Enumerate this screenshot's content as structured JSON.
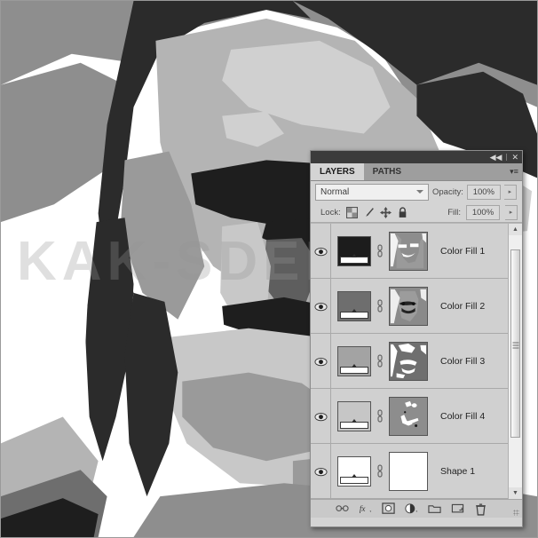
{
  "canvas": {
    "artwork_title": "posterized-grayscale-portrait",
    "watermark_text": "KAK-SDELA"
  },
  "panel": {
    "titlebar": {
      "collapse_icon": "◀◀",
      "close_icon": "✕"
    },
    "tabs": [
      {
        "label": "LAYERS",
        "active": true
      },
      {
        "label": "PATHS",
        "active": false
      }
    ],
    "menu_icon": "▾≡",
    "blend": {
      "mode_value": "Normal",
      "opacity_label": "Opacity:",
      "opacity_value": "100%",
      "stepper_icon": "▸"
    },
    "lock": {
      "label": "Lock:",
      "icons": [
        "transparency-icon",
        "brush-icon",
        "move-icon",
        "lock-icon"
      ],
      "fill_label": "Fill:",
      "fill_value": "100%",
      "stepper_icon": "▸"
    },
    "layers": [
      {
        "name": "Color Fill 1",
        "visible": true,
        "fill_color": "#1c1c1c",
        "mask": "mask-face-1"
      },
      {
        "name": "Color Fill 2",
        "visible": true,
        "fill_color": "#6e6e6e",
        "mask": "mask-face-2"
      },
      {
        "name": "Color Fill 3",
        "visible": true,
        "fill_color": "#a3a3a3",
        "mask": "mask-face-3"
      },
      {
        "name": "Color Fill 4",
        "visible": true,
        "fill_color": "#c6c6c6",
        "mask": "mask-face-4"
      },
      {
        "name": "Shape 1",
        "visible": true,
        "fill_color": "#ffffff",
        "mask": "mask-blank"
      }
    ],
    "scrollbar": {
      "up_icon": "▲",
      "down_icon": "▼"
    },
    "footer_buttons": [
      {
        "name": "link-layers-button",
        "icon": "link-icon"
      },
      {
        "name": "layer-style-button",
        "icon": "fx-icon"
      },
      {
        "name": "add-mask-button",
        "icon": "mask-icon"
      },
      {
        "name": "adjustment-layer-button",
        "icon": "halfcircle-icon"
      },
      {
        "name": "new-group-button",
        "icon": "folder-icon"
      },
      {
        "name": "new-layer-button",
        "icon": "new-layer-icon"
      },
      {
        "name": "delete-layer-button",
        "icon": "trash-icon"
      }
    ]
  },
  "colors": {
    "panel_bg": "#d4d4d4",
    "titlebar": "#3b3b3b",
    "tab_inactive": "#9e9e9e",
    "row_bg": "#d0d0d0"
  }
}
